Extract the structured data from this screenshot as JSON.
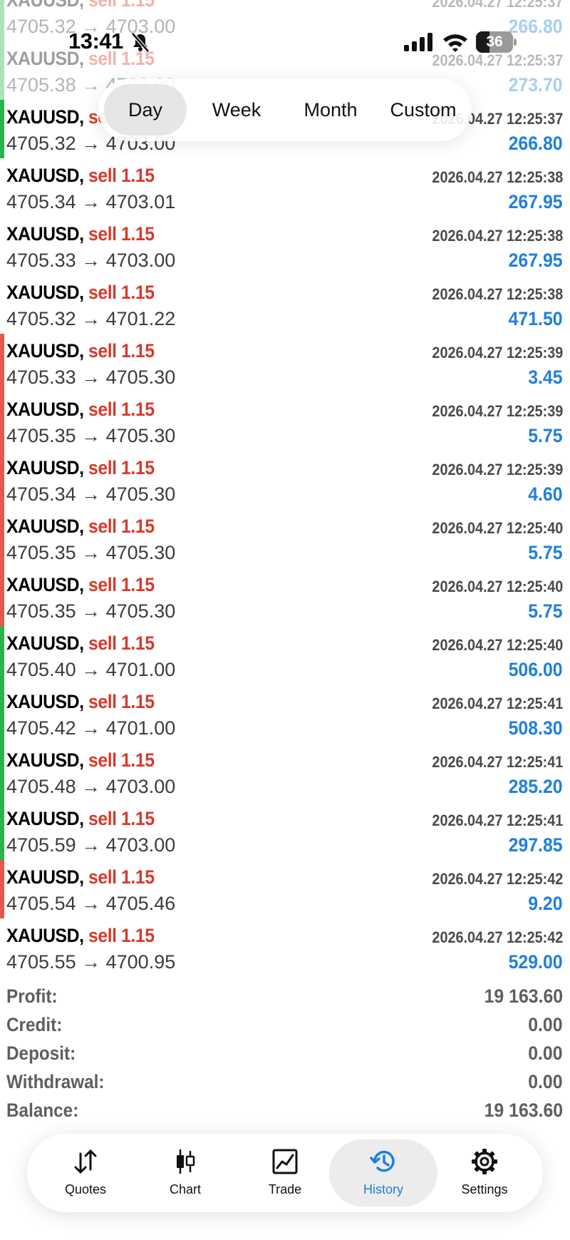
{
  "status_bar": {
    "time": "13:41",
    "battery": "36",
    "battery_level": 0.36
  },
  "period_tabs": [
    {
      "label": "Day",
      "active": true
    },
    {
      "label": "Week",
      "active": false
    },
    {
      "label": "Month",
      "active": false
    },
    {
      "label": "Custom",
      "active": false
    }
  ],
  "colors": {
    "profit_bar": "#2bb24c",
    "loss_bar": "#e05a4f",
    "sell": "#d73a2d",
    "profit_text": "#1f7fe0"
  },
  "trades": [
    {
      "symbol": "XAUUSD,",
      "side": "sell 1.15",
      "open": "4705.32",
      "close": "4703.00",
      "time": "2026.04.27 12:25:37",
      "profit": "266.80",
      "bar": "green",
      "faded": true
    },
    {
      "symbol": "XAUUSD,",
      "side": "sell 1.15",
      "open": "4705.38",
      "close": "4703.00",
      "time": "2026.04.27 12:25:37",
      "profit": "273.70",
      "bar": "green",
      "faded": true
    },
    {
      "symbol": "XAUUSD,",
      "side": "sell 1.15",
      "open": "4705.32",
      "close": "4703.00",
      "time": "2026.04.27 12:25:37",
      "profit": "266.80",
      "bar": "green",
      "faded": false
    },
    {
      "symbol": "XAUUSD,",
      "side": "sell 1.15",
      "open": "4705.34",
      "close": "4703.01",
      "time": "2026.04.27 12:25:38",
      "profit": "267.95",
      "bar": "none",
      "faded": false
    },
    {
      "symbol": "XAUUSD,",
      "side": "sell 1.15",
      "open": "4705.33",
      "close": "4703.00",
      "time": "2026.04.27 12:25:38",
      "profit": "267.95",
      "bar": "none",
      "faded": false
    },
    {
      "symbol": "XAUUSD,",
      "side": "sell 1.15",
      "open": "4705.32",
      "close": "4701.22",
      "time": "2026.04.27 12:25:38",
      "profit": "471.50",
      "bar": "none",
      "faded": false
    },
    {
      "symbol": "XAUUSD,",
      "side": "sell 1.15",
      "open": "4705.33",
      "close": "4705.30",
      "time": "2026.04.27 12:25:39",
      "profit": "3.45",
      "bar": "red",
      "faded": false
    },
    {
      "symbol": "XAUUSD,",
      "side": "sell 1.15",
      "open": "4705.35",
      "close": "4705.30",
      "time": "2026.04.27 12:25:39",
      "profit": "5.75",
      "bar": "red",
      "faded": false
    },
    {
      "symbol": "XAUUSD,",
      "side": "sell 1.15",
      "open": "4705.34",
      "close": "4705.30",
      "time": "2026.04.27 12:25:39",
      "profit": "4.60",
      "bar": "red",
      "faded": false
    },
    {
      "symbol": "XAUUSD,",
      "side": "sell 1.15",
      "open": "4705.35",
      "close": "4705.30",
      "time": "2026.04.27 12:25:40",
      "profit": "5.75",
      "bar": "red",
      "faded": false
    },
    {
      "symbol": "XAUUSD,",
      "side": "sell 1.15",
      "open": "4705.35",
      "close": "4705.30",
      "time": "2026.04.27 12:25:40",
      "profit": "5.75",
      "bar": "red",
      "faded": false
    },
    {
      "symbol": "XAUUSD,",
      "side": "sell 1.15",
      "open": "4705.40",
      "close": "4701.00",
      "time": "2026.04.27 12:25:40",
      "profit": "506.00",
      "bar": "green",
      "faded": false
    },
    {
      "symbol": "XAUUSD,",
      "side": "sell 1.15",
      "open": "4705.42",
      "close": "4701.00",
      "time": "2026.04.27 12:25:41",
      "profit": "508.30",
      "bar": "green",
      "faded": false
    },
    {
      "symbol": "XAUUSD,",
      "side": "sell 1.15",
      "open": "4705.48",
      "close": "4703.00",
      "time": "2026.04.27 12:25:41",
      "profit": "285.20",
      "bar": "green",
      "faded": false
    },
    {
      "symbol": "XAUUSD,",
      "side": "sell 1.15",
      "open": "4705.59",
      "close": "4703.00",
      "time": "2026.04.27 12:25:41",
      "profit": "297.85",
      "bar": "green",
      "faded": false
    },
    {
      "symbol": "XAUUSD,",
      "side": "sell 1.15",
      "open": "4705.54",
      "close": "4705.46",
      "time": "2026.04.27 12:25:42",
      "profit": "9.20",
      "bar": "red",
      "faded": false
    },
    {
      "symbol": "XAUUSD,",
      "side": "sell 1.15",
      "open": "4705.55",
      "close": "4700.95",
      "time": "2026.04.27 12:25:42",
      "profit": "529.00",
      "bar": "none",
      "faded": false
    }
  ],
  "summary": [
    {
      "label": "Profit:",
      "value": "19 163.60"
    },
    {
      "label": "Credit:",
      "value": "0.00"
    },
    {
      "label": "Deposit:",
      "value": "0.00"
    },
    {
      "label": "Withdrawal:",
      "value": "0.00"
    },
    {
      "label": "Balance:",
      "value": "19 163.60"
    }
  ],
  "nav": [
    {
      "label": "Quotes",
      "icon": "arrows-updown-icon",
      "active": false
    },
    {
      "label": "Chart",
      "icon": "candlestick-icon",
      "active": false
    },
    {
      "label": "Trade",
      "icon": "trade-chart-icon",
      "active": false
    },
    {
      "label": "History",
      "icon": "history-clock-icon",
      "active": true
    },
    {
      "label": "Settings",
      "icon": "gear-icon",
      "active": false
    }
  ]
}
